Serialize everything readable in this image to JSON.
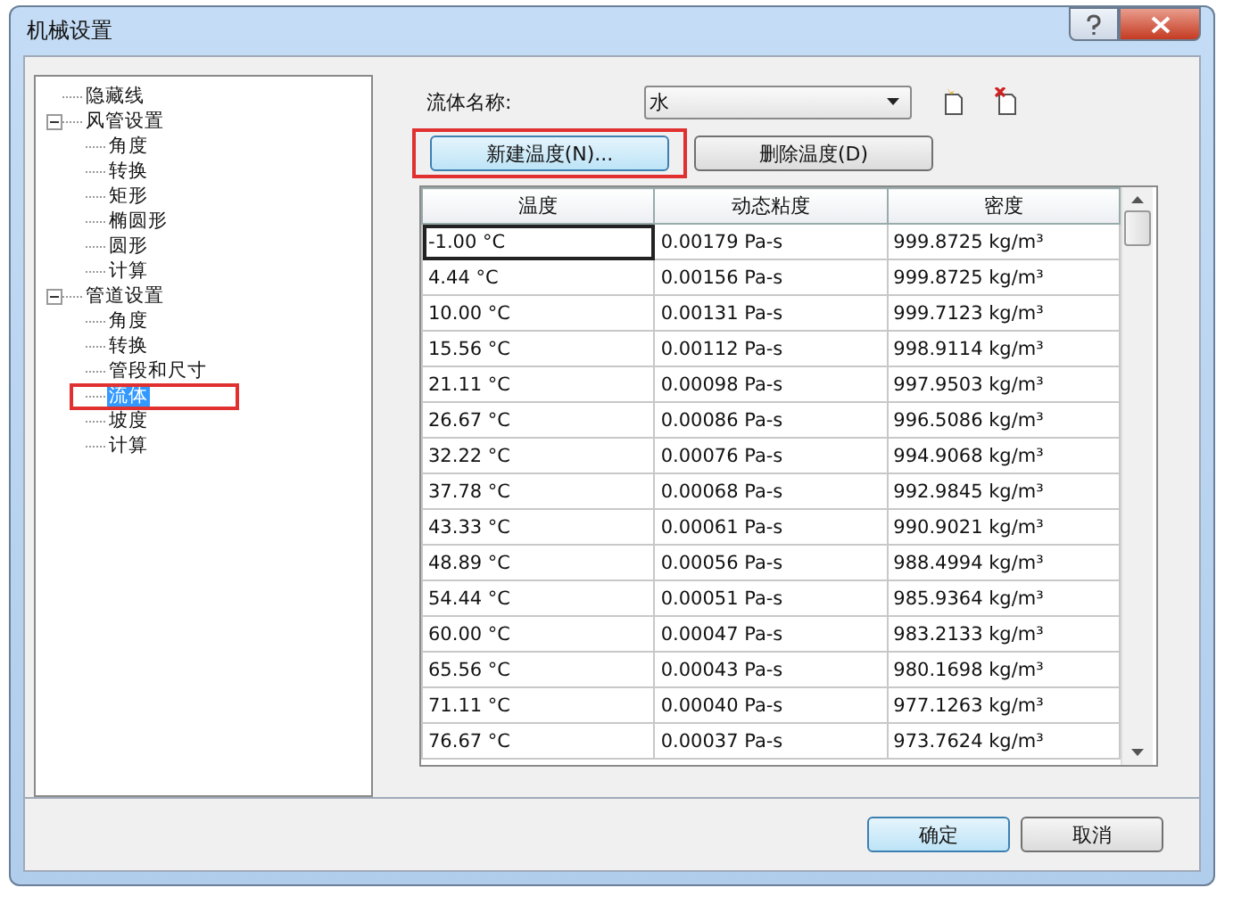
{
  "window": {
    "title": "机械设置"
  },
  "tree": [
    {
      "label": "隐藏线",
      "selected": false
    },
    {
      "label": "风管设置",
      "selected": false,
      "expanded": true,
      "children": [
        {
          "label": "角度",
          "selected": false
        },
        {
          "label": "转换",
          "selected": false
        },
        {
          "label": "矩形",
          "selected": false
        },
        {
          "label": "椭圆形",
          "selected": false
        },
        {
          "label": "圆形",
          "selected": false
        },
        {
          "label": "计算",
          "selected": false
        }
      ]
    },
    {
      "label": "管道设置",
      "selected": false,
      "expanded": true,
      "children": [
        {
          "label": "角度",
          "selected": false
        },
        {
          "label": "转换",
          "selected": false
        },
        {
          "label": "管段和尺寸",
          "selected": false
        },
        {
          "label": "流体",
          "selected": true
        },
        {
          "label": "坡度",
          "selected": false
        },
        {
          "label": "计算",
          "selected": false
        }
      ]
    }
  ],
  "fluid_name": {
    "label": "流体名称:",
    "value": "水"
  },
  "buttons": [
    {
      "label": "新建温度(N)...",
      "focused": true
    },
    {
      "label": "删除温度(D)",
      "focused": false
    }
  ],
  "table": {
    "columns": [
      "温度",
      "动态粘度",
      "密度"
    ],
    "rows": [
      [
        "-1.00 °C",
        "0.00179 Pa-s",
        "999.8725 kg/m³"
      ],
      [
        "4.44 °C",
        "0.00156 Pa-s",
        "999.8725 kg/m³"
      ],
      [
        "10.00 °C",
        "0.00131 Pa-s",
        "999.7123 kg/m³"
      ],
      [
        "15.56 °C",
        "0.00112 Pa-s",
        "998.9114 kg/m³"
      ],
      [
        "21.11 °C",
        "0.00098 Pa-s",
        "997.9503 kg/m³"
      ],
      [
        "26.67 °C",
        "0.00086 Pa-s",
        "996.5086 kg/m³"
      ],
      [
        "32.22 °C",
        "0.00076 Pa-s",
        "994.9068 kg/m³"
      ],
      [
        "37.78 °C",
        "0.00068 Pa-s",
        "992.9845 kg/m³"
      ],
      [
        "43.33 °C",
        "0.00061 Pa-s",
        "990.9021 kg/m³"
      ],
      [
        "48.89 °C",
        "0.00056 Pa-s",
        "988.4994 kg/m³"
      ],
      [
        "54.44 °C",
        "0.00051 Pa-s",
        "985.9364 kg/m³"
      ],
      [
        "60.00 °C",
        "0.00047 Pa-s",
        "983.2133 kg/m³"
      ],
      [
        "65.56 °C",
        "0.00043 Pa-s",
        "980.1698 kg/m³"
      ],
      [
        "71.11 °C",
        "0.00040 Pa-s",
        "977.1263 kg/m³"
      ],
      [
        "76.67 °C",
        "0.00037 Pa-s",
        "973.7624 kg/m³"
      ]
    ]
  },
  "footer_buttons": [
    {
      "label": "确定",
      "focused": true
    },
    {
      "label": "取消",
      "focused": false
    }
  ]
}
